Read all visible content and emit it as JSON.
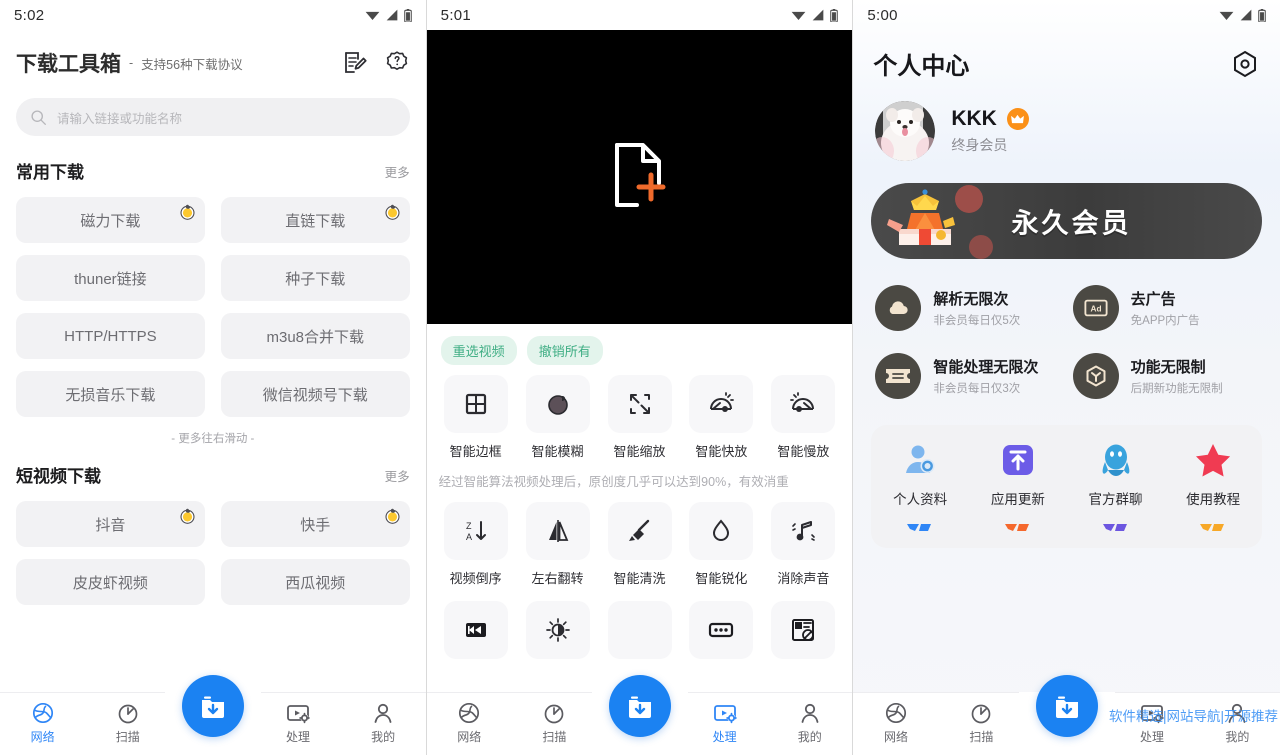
{
  "panel1": {
    "status": {
      "time": "5:02"
    },
    "header": {
      "title": "下载工具箱",
      "dash": "-",
      "subtitle": "支持56种下载协议",
      "edit_icon": "note-edit-icon",
      "help_icon": "help-badge-icon"
    },
    "search": {
      "placeholder": "请输入链接或功能名称",
      "icon": "search-icon"
    },
    "sections": [
      {
        "title": "常用下载",
        "more": "更多",
        "items": [
          {
            "label": "磁力下载",
            "hot": true
          },
          {
            "label": "直链下载",
            "hot": true
          },
          {
            "label": "thuner链接",
            "hot": false
          },
          {
            "label": "种子下载",
            "hot": false
          },
          {
            "label": "HTTP/HTTPS",
            "hot": false
          },
          {
            "label": "m3u8合并下载",
            "hot": false
          },
          {
            "label": "无损音乐下载",
            "hot": false
          },
          {
            "label": "微信视频号下载",
            "hot": false
          }
        ],
        "hint": "- 更多往右滑动 -"
      },
      {
        "title": "短视频下载",
        "more": "更多",
        "items": [
          {
            "label": "抖音",
            "hot": true
          },
          {
            "label": "快手",
            "hot": true
          },
          {
            "label": "皮皮虾视频",
            "hot": false
          },
          {
            "label": "西瓜视频",
            "hot": false
          }
        ]
      }
    ],
    "nav": {
      "active": "网络",
      "items": [
        {
          "label": "网络",
          "icon": "globe-icon"
        },
        {
          "label": "扫描",
          "icon": "scan-timer-icon"
        },
        {
          "label": "",
          "icon": "download-fab-icon"
        },
        {
          "label": "处理",
          "icon": "video-settings-icon"
        },
        {
          "label": "我的",
          "icon": "person-icon"
        }
      ]
    }
  },
  "panel2": {
    "status": {
      "time": "5:01"
    },
    "preview": {
      "icon": "file-add-icon",
      "background": "#000000"
    },
    "chips": [
      {
        "label": "重选视频"
      },
      {
        "label": "撤销所有"
      }
    ],
    "tools_row1": [
      {
        "label": "智能边框",
        "icon": "grid-frame-icon"
      },
      {
        "label": "智能模糊",
        "icon": "blur-circle-icon"
      },
      {
        "label": "智能缩放",
        "icon": "scale-arrows-icon"
      },
      {
        "label": "智能快放",
        "icon": "fast-forward-gauge-icon"
      },
      {
        "label": "智能慢放",
        "icon": "slow-motion-gauge-icon"
      }
    ],
    "note": "经过智能算法视频处理后，原创度几乎可以达到90%，有效消重",
    "tools_row2": [
      {
        "label": "视频倒序",
        "icon": "sort-za-icon"
      },
      {
        "label": "左右翻转",
        "icon": "flip-horizontal-icon"
      },
      {
        "label": "智能清洗",
        "icon": "broom-icon"
      },
      {
        "label": "智能锐化",
        "icon": "water-drop-icon"
      },
      {
        "label": "消除声音",
        "icon": "mute-note-icon"
      }
    ],
    "tools_row3": [
      {
        "label": "",
        "icon": "rewind-icon"
      },
      {
        "label": "",
        "icon": "brightness-icon"
      },
      {
        "label": "",
        "icon": "hidden-icon"
      },
      {
        "label": "",
        "icon": "dots-box-icon"
      },
      {
        "label": "",
        "icon": "watermark-remove-icon"
      }
    ],
    "nav": {
      "active": "处理",
      "items": [
        {
          "label": "网络",
          "icon": "globe-icon"
        },
        {
          "label": "扫描",
          "icon": "scan-timer-icon"
        },
        {
          "label": "",
          "icon": "download-fab-icon"
        },
        {
          "label": "处理",
          "icon": "video-settings-icon"
        },
        {
          "label": "我的",
          "icon": "person-icon"
        }
      ]
    }
  },
  "panel3": {
    "status": {
      "time": "5:00"
    },
    "header": {
      "title": "个人中心",
      "settings_icon": "hex-settings-icon"
    },
    "user": {
      "name": "KKK",
      "level": "终身会员",
      "crown_icon": "crown-icon",
      "avatar": "dog-avatar"
    },
    "vip_banner": {
      "text": "永久会员",
      "gift_icon": "gift-crown-icon"
    },
    "benefits": [
      {
        "title": "解析无限次",
        "sub": "非会员每日仅5次",
        "icon": "cloud-icon"
      },
      {
        "title": "去广告",
        "sub": "免APP内广告",
        "icon": "ad-icon"
      },
      {
        "title": "智能处理无限次",
        "sub": "非会员每日仅3次",
        "icon": "ticket-icon"
      },
      {
        "title": "功能无限制",
        "sub": "后期新功能无限制",
        "icon": "cube-icon"
      }
    ],
    "quick_actions": [
      {
        "label": "个人资料",
        "icon": "user-profile-icon",
        "color": "#5ba7e8"
      },
      {
        "label": "应用更新",
        "icon": "app-update-icon",
        "color": "#6c5ce7"
      },
      {
        "label": "官方群聊",
        "icon": "qq-penguin-icon",
        "color": "#2f9ad6"
      },
      {
        "label": "使用教程",
        "icon": "star-icon",
        "color": "#f03b52"
      }
    ],
    "quick_actions_row2": [
      {
        "icon": "partial-blue-icon",
        "color": "#2f86f6"
      },
      {
        "icon": "partial-orange-icon",
        "color": "#f5682c"
      },
      {
        "icon": "partial-purple-icon",
        "color": "#6c56e0"
      },
      {
        "icon": "partial-yellow-icon",
        "color": "#f7a827"
      }
    ],
    "watermark": "软件精选|网站导航|开源推荐",
    "nav": {
      "active": "",
      "items": [
        {
          "label": "网络",
          "icon": "globe-icon"
        },
        {
          "label": "扫描",
          "icon": "scan-timer-icon"
        },
        {
          "label": "",
          "icon": "download-fab-icon"
        },
        {
          "label": "处理",
          "icon": "video-settings-icon"
        },
        {
          "label": "我的",
          "icon": "person-icon"
        }
      ]
    }
  },
  "colors": {
    "accent_blue": "#2f86f6",
    "fab_blue": "#1b82f2",
    "chip_green_bg": "#e3f4ec",
    "chip_green_text": "#3fae84",
    "crown_orange": "#fb9017",
    "watermark_blue": "#3f94f5"
  }
}
